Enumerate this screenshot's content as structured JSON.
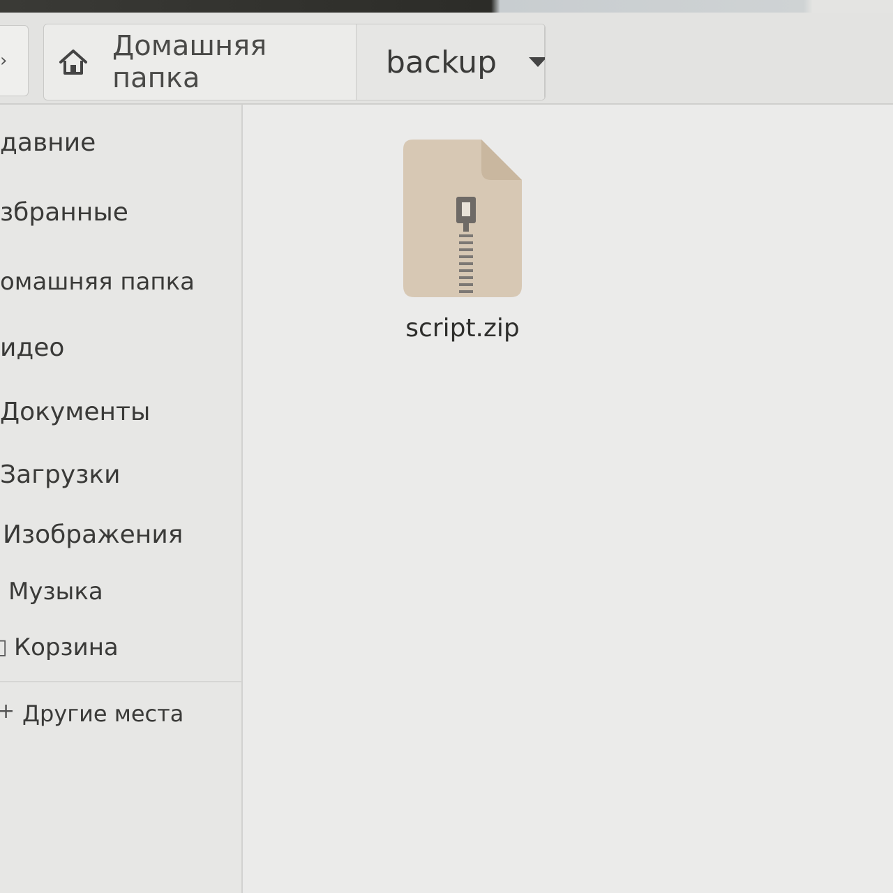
{
  "header": {
    "nav_forward_glyph": "›",
    "breadcrumb": {
      "home_label": "Домашняя папка",
      "current_label": "backup"
    },
    "window_button_glyph": "←"
  },
  "sidebar": {
    "items": [
      {
        "label": "давние",
        "icon": "clock-icon"
      },
      {
        "label": "збранные",
        "icon": "star-icon"
      },
      {
        "label": "омашняя папка",
        "icon": "home-icon"
      },
      {
        "label": "идео",
        "icon": "video-icon"
      },
      {
        "label": "Документы",
        "icon": "document-icon"
      },
      {
        "label": "Загрузки",
        "icon": "download-icon"
      },
      {
        "label": "Изображения",
        "icon": "image-icon"
      },
      {
        "label": "Музыка",
        "icon": "music-icon"
      },
      {
        "label": "Корзина",
        "icon": "trash-icon"
      }
    ],
    "other_places": {
      "label": "Другие места",
      "icon": "plus-icon",
      "glyph": "+"
    }
  },
  "files": [
    {
      "name": "script.zip",
      "icon": "zip-archive-icon"
    }
  ],
  "colors": {
    "archive_icon_fill": "#d7c8b4",
    "archive_icon_fold": "#c9b79f",
    "zipper": "#6e6a66",
    "background": "#ebebea"
  }
}
